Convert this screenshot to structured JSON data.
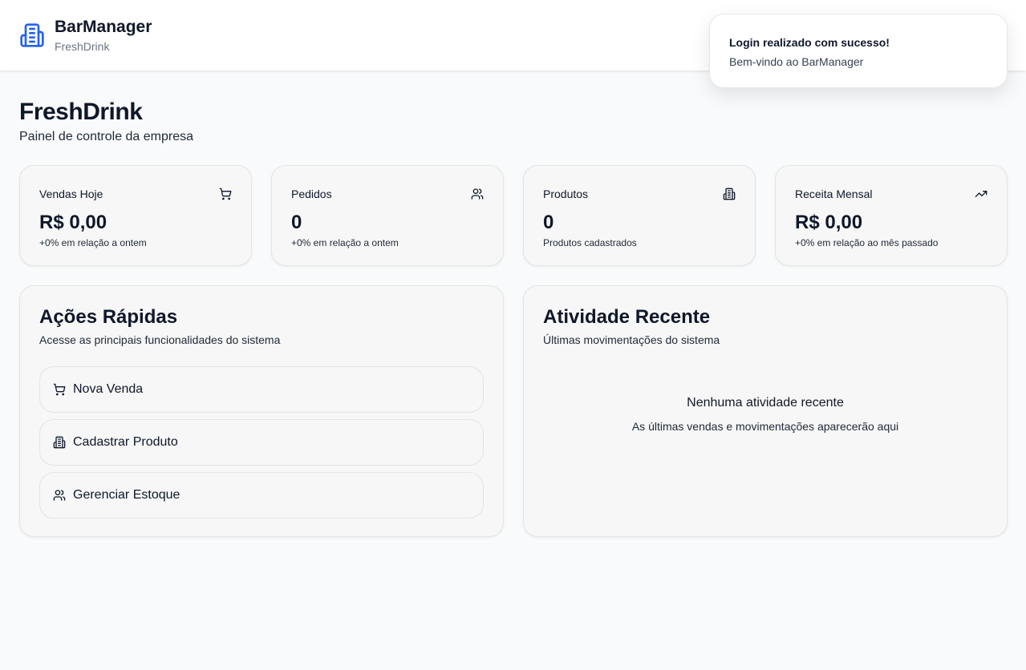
{
  "app": {
    "name": "BarManager",
    "company": "FreshDrink"
  },
  "toast": {
    "title": "Login realizado com sucesso!",
    "description": "Bem-vindo ao BarManager"
  },
  "page": {
    "title": "FreshDrink",
    "subtitle": "Painel de controle da empresa"
  },
  "stats": [
    {
      "label": "Vendas Hoje",
      "value": "R$ 0,00",
      "note": "+0% em relação a ontem",
      "icon": "shopping-cart-icon"
    },
    {
      "label": "Pedidos",
      "value": "0",
      "note": "+0% em relação a ontem",
      "icon": "users-icon"
    },
    {
      "label": "Produtos",
      "value": "0",
      "note": "Produtos cadastrados",
      "icon": "building-icon"
    },
    {
      "label": "Receita Mensal",
      "value": "R$ 0,00",
      "note": "+0% em relação ao mês passado",
      "icon": "trending-up-icon"
    }
  ],
  "quick_actions": {
    "title": "Ações Rápidas",
    "description": "Acesse as principais funcionalidades do sistema",
    "items": [
      {
        "label": "Nova Venda",
        "icon": "shopping-cart-icon"
      },
      {
        "label": "Cadastrar Produto",
        "icon": "building-icon"
      },
      {
        "label": "Gerenciar Estoque",
        "icon": "users-icon"
      }
    ]
  },
  "recent_activity": {
    "title": "Atividade Recente",
    "description": "Últimas movimentações do sistema",
    "empty_title": "Nenhuma atividade recente",
    "empty_description": "As últimas vendas e movimentações aparecerão aqui"
  },
  "colors": {
    "brand": "#2563eb",
    "card_bg": "#f6f7f6",
    "page_bg": "#f9fafb"
  }
}
